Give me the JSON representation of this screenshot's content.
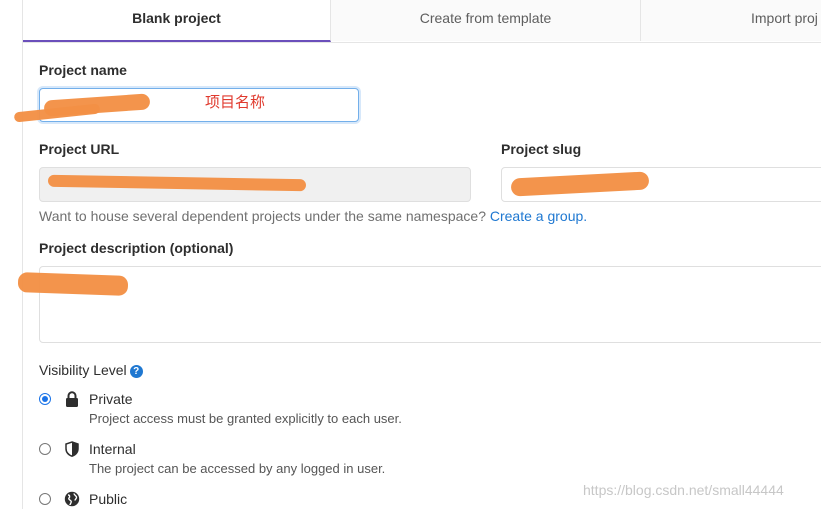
{
  "tabs": [
    {
      "label": "Blank project"
    },
    {
      "label": "Create from template"
    },
    {
      "label": "Import proj"
    }
  ],
  "form": {
    "project_name": {
      "label": "Project name",
      "annotation": "项目名称"
    },
    "project_url": {
      "label": "Project URL"
    },
    "project_slug": {
      "label": "Project slug"
    },
    "namespace_help": {
      "text": "Want to house several dependent projects under the same namespace?",
      "link": "Create a group."
    },
    "description": {
      "label": "Project description (optional)"
    }
  },
  "visibility": {
    "label": "Visibility Level",
    "help_glyph": "?",
    "selected": "Private",
    "options": [
      {
        "title": "Private",
        "desc": "Project access must be granted explicitly to each user.",
        "icon": "lock-icon"
      },
      {
        "title": "Internal",
        "desc": "The project can be accessed by any logged in user.",
        "icon": "shield-icon"
      },
      {
        "title": "Public",
        "desc": "",
        "icon": "globe-icon"
      }
    ]
  },
  "watermark": "https://blog.csdn.net/small44444",
  "colors": {
    "accent": "#6b4fbb",
    "link": "#1f78d1",
    "annotation": "#e03a2e",
    "redaction": "#f39045"
  }
}
